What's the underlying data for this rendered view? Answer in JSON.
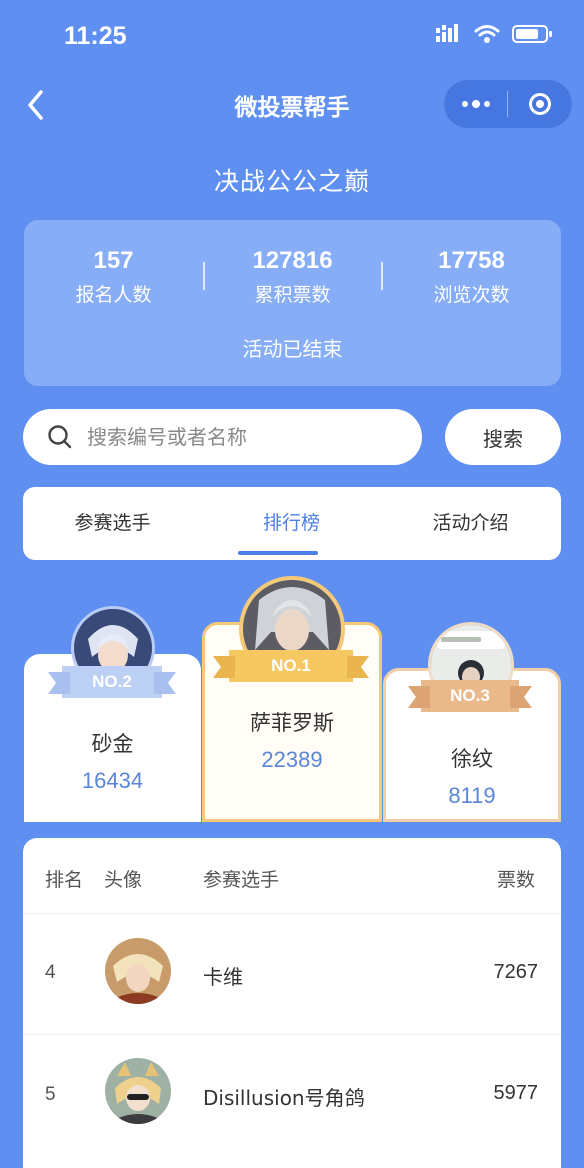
{
  "status_bar": {
    "time": "11:25"
  },
  "nav": {
    "title": "微投票帮手"
  },
  "event": {
    "title": "决战公公之巅"
  },
  "stats": [
    {
      "value": "157",
      "label": "报名人数"
    },
    {
      "value": "127816",
      "label": "累积票数"
    },
    {
      "value": "17758",
      "label": "浏览次数"
    }
  ],
  "status_text": "活动已结束",
  "search": {
    "placeholder": "搜索编号或者名称",
    "button_label": "搜索"
  },
  "tabs": [
    {
      "label": "参赛选手",
      "active": false
    },
    {
      "label": "排行榜",
      "active": true
    },
    {
      "label": "活动介绍",
      "active": false
    }
  ],
  "podium": [
    {
      "rank_label": "NO.2",
      "name": "砂金",
      "votes": "16434"
    },
    {
      "rank_label": "NO.1",
      "name": "萨菲罗斯",
      "votes": "22389"
    },
    {
      "rank_label": "NO.3",
      "name": "徐纹",
      "votes": "8119"
    }
  ],
  "table": {
    "headers": {
      "rank": "排名",
      "avatar": "头像",
      "player": "参赛选手",
      "votes": "票数"
    },
    "rows": [
      {
        "rank": "4",
        "name": "卡维",
        "votes": "7267"
      },
      {
        "rank": "5",
        "name": "Disillusion号角鸽",
        "votes": "5977"
      }
    ]
  },
  "colors": {
    "background": "#5f8ff0",
    "accent": "#4d7fe6",
    "gold": "#f5c978",
    "silver": "#b9ccf5",
    "bronze": "#e9b98b"
  },
  "icons": [
    "back-icon",
    "more-icon",
    "close-mini-program-icon",
    "search-icon",
    "signal-icon",
    "wifi-icon",
    "battery-icon"
  ]
}
